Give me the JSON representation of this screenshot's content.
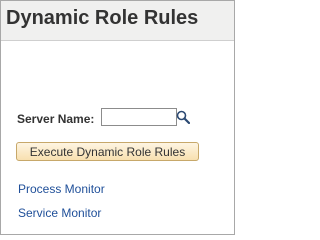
{
  "header": {
    "title": "Dynamic Role Rules",
    "background": "#f0f0ef"
  },
  "form": {
    "server_name_label": "Server Name:",
    "server_name_value": "",
    "lookup_icon": "search-icon",
    "execute_button_label": "Execute Dynamic Role Rules",
    "button_color": "#fbe8c4"
  },
  "links": {
    "process_monitor": "Process Monitor",
    "service_monitor": "Service Monitor",
    "link_color": "#1f4f99"
  }
}
